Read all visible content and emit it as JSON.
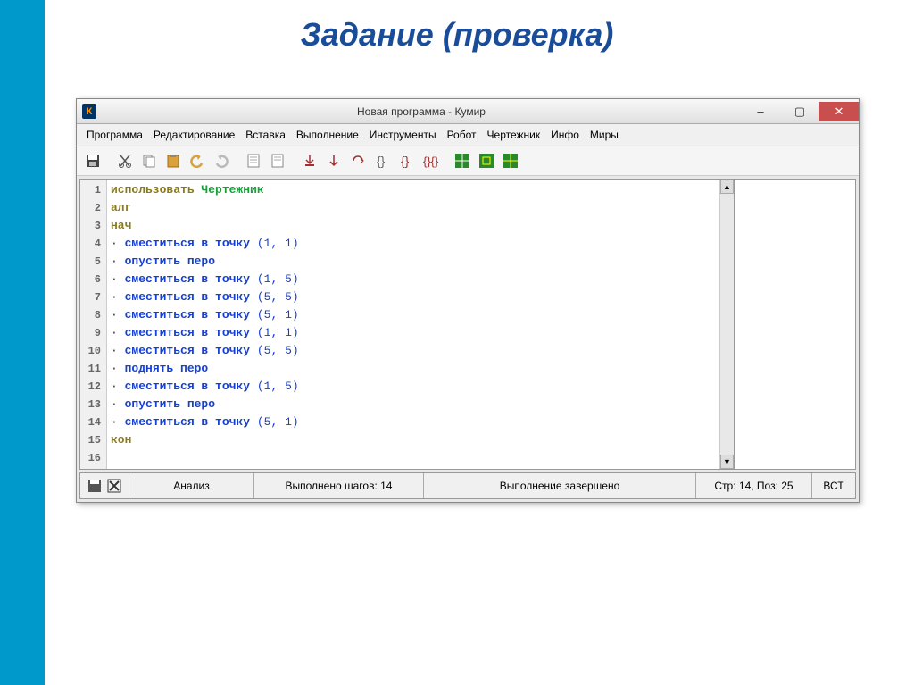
{
  "page": {
    "title": "Задание (проверка)"
  },
  "window": {
    "title": "Новая программа - Кумир",
    "app_icon_letter": "К"
  },
  "menu": [
    "Программа",
    "Редактирование",
    "Вставка",
    "Выполнение",
    "Инструменты",
    "Робот",
    "Чертежник",
    "Инфо",
    "Миры"
  ],
  "code": {
    "lines": [
      {
        "n": 1,
        "segments": [
          {
            "t": "использовать ",
            "c": "kw-olive"
          },
          {
            "t": "Чертежник",
            "c": "kw-green"
          }
        ]
      },
      {
        "n": 2,
        "segments": [
          {
            "t": "алг",
            "c": "kw-olive"
          }
        ]
      },
      {
        "n": 3,
        "segments": [
          {
            "t": "нач",
            "c": "kw-olive"
          }
        ]
      },
      {
        "n": 4,
        "bullet": true,
        "segments": [
          {
            "t": "сместиться в точку",
            "c": "kw-blue"
          },
          {
            "t": " (",
            "c": "paren"
          },
          {
            "t": "1",
            "c": "num"
          },
          {
            "t": ", ",
            "c": "comma"
          },
          {
            "t": "1",
            "c": "num"
          },
          {
            "t": ")",
            "c": "paren"
          }
        ]
      },
      {
        "n": 5,
        "bullet": true,
        "segments": [
          {
            "t": "опустить перо",
            "c": "kw-blue"
          }
        ]
      },
      {
        "n": 6,
        "bullet": true,
        "segments": [
          {
            "t": "сместиться в точку",
            "c": "kw-blue"
          },
          {
            "t": " (",
            "c": "paren"
          },
          {
            "t": "1",
            "c": "num"
          },
          {
            "t": ", ",
            "c": "comma"
          },
          {
            "t": "5",
            "c": "num"
          },
          {
            "t": ")",
            "c": "paren"
          }
        ]
      },
      {
        "n": 7,
        "bullet": true,
        "segments": [
          {
            "t": "сместиться в точку",
            "c": "kw-blue"
          },
          {
            "t": " (",
            "c": "paren"
          },
          {
            "t": "5",
            "c": "num"
          },
          {
            "t": ", ",
            "c": "comma"
          },
          {
            "t": "5",
            "c": "num"
          },
          {
            "t": ")",
            "c": "paren"
          }
        ]
      },
      {
        "n": 8,
        "bullet": true,
        "segments": [
          {
            "t": "сместиться в точку",
            "c": "kw-blue"
          },
          {
            "t": " (",
            "c": "paren"
          },
          {
            "t": "5",
            "c": "num"
          },
          {
            "t": ", ",
            "c": "comma"
          },
          {
            "t": "1",
            "c": "num"
          },
          {
            "t": ")",
            "c": "paren"
          }
        ]
      },
      {
        "n": 9,
        "bullet": true,
        "segments": [
          {
            "t": "сместиться в точку",
            "c": "kw-blue"
          },
          {
            "t": " (",
            "c": "paren"
          },
          {
            "t": "1",
            "c": "num"
          },
          {
            "t": ", ",
            "c": "comma"
          },
          {
            "t": "1",
            "c": "num"
          },
          {
            "t": ")",
            "c": "paren"
          }
        ]
      },
      {
        "n": 10,
        "bullet": true,
        "segments": [
          {
            "t": "сместиться в точку",
            "c": "kw-blue"
          },
          {
            "t": " (",
            "c": "paren"
          },
          {
            "t": "5",
            "c": "num"
          },
          {
            "t": ", ",
            "c": "comma"
          },
          {
            "t": "5",
            "c": "num"
          },
          {
            "t": ")",
            "c": "paren"
          }
        ]
      },
      {
        "n": 11,
        "bullet": true,
        "segments": [
          {
            "t": "поднять перо",
            "c": "kw-blue"
          }
        ]
      },
      {
        "n": 12,
        "bullet": true,
        "segments": [
          {
            "t": "сместиться в точку",
            "c": "kw-blue"
          },
          {
            "t": " (",
            "c": "paren"
          },
          {
            "t": "1",
            "c": "num"
          },
          {
            "t": ", ",
            "c": "comma"
          },
          {
            "t": "5",
            "c": "num"
          },
          {
            "t": ")",
            "c": "paren"
          }
        ]
      },
      {
        "n": 13,
        "bullet": true,
        "segments": [
          {
            "t": "опустить перо",
            "c": "kw-blue"
          }
        ]
      },
      {
        "n": 14,
        "bullet": true,
        "segments": [
          {
            "t": "сместиться в точку",
            "c": "kw-blue"
          },
          {
            "t": " (",
            "c": "paren"
          },
          {
            "t": "5",
            "c": "num"
          },
          {
            "t": ", ",
            "c": "comma"
          },
          {
            "t": "1",
            "c": "num"
          },
          {
            "t": ")",
            "c": "paren"
          }
        ]
      },
      {
        "n": 15,
        "segments": [
          {
            "t": "кон",
            "c": "kw-olive"
          }
        ]
      },
      {
        "n": 16,
        "segments": []
      }
    ]
  },
  "status": {
    "analyze": "Анализ",
    "steps": "Выполнено шагов: 14",
    "done": "Выполнение завершено",
    "pos": "Стр: 14, Поз: 25",
    "mode": "ВСТ"
  }
}
